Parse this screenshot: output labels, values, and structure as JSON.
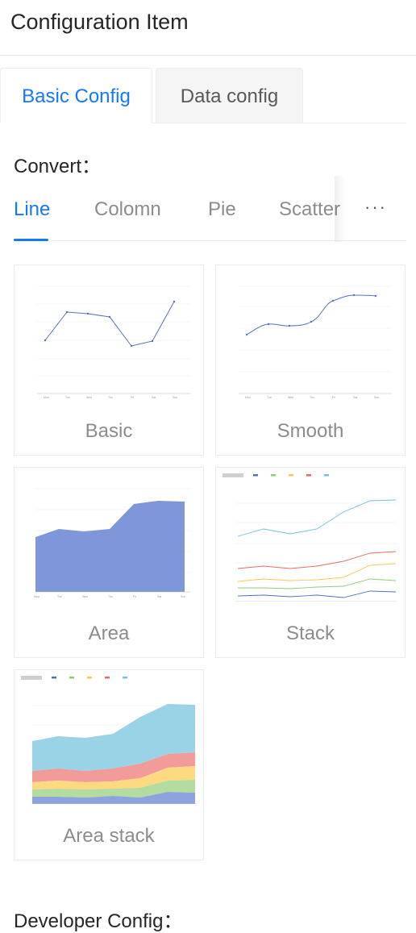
{
  "header": {
    "title": "Configuration Item"
  },
  "tabs": [
    {
      "label": "Basic Config",
      "active": true
    },
    {
      "label": "Data config",
      "active": false
    }
  ],
  "convert": {
    "label": "Convert：",
    "tabs": [
      "Line",
      "Colomn",
      "Pie",
      "Scatter"
    ],
    "active_tab": "Line",
    "more_label": "···"
  },
  "cards": [
    {
      "caption": "Basic"
    },
    {
      "caption": "Smooth"
    },
    {
      "caption": "Area"
    },
    {
      "caption": "Stack"
    },
    {
      "caption": "Area stack"
    }
  ],
  "developer": {
    "label": "Developer Config："
  },
  "colors": {
    "accent": "#1677ff",
    "series": [
      "#5470c6",
      "#91cc75",
      "#fac858",
      "#ee6666",
      "#73c0de"
    ]
  }
}
